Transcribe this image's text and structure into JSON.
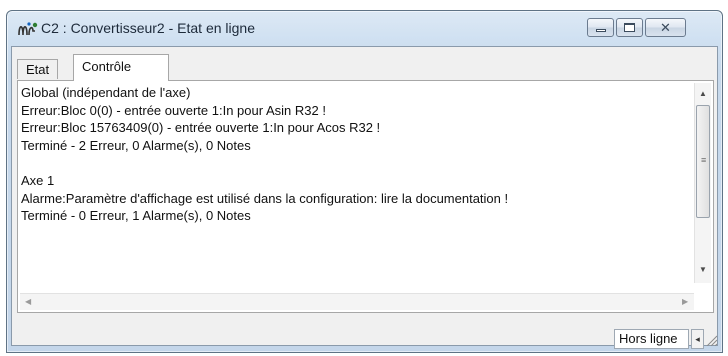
{
  "window": {
    "title": "C2 : Convertisseur2 - Etat en ligne"
  },
  "tabs": [
    {
      "label": "Etat",
      "active": false
    },
    {
      "label": "Contrôle",
      "active": true
    }
  ],
  "log": {
    "lines": [
      "Global (indépendant de l'axe)",
      "Erreur:Bloc 0(0) - entrée ouverte 1:In pour Asin R32 !",
      "Erreur:Bloc 15763409(0) - entrée ouverte 1:In pour Acos R32 !",
      "Terminé - 2 Erreur, 0 Alarme(s), 0 Notes",
      "",
      "Axe 1",
      "Alarme:Paramètre d'affichage est utilisé dans la configuration: lire la documentation !",
      "Terminé - 0 Erreur, 1 Alarme(s), 0 Notes"
    ]
  },
  "statusbar": {
    "pane_text": "Hors ligne"
  },
  "icons": {
    "app": "app-icon",
    "minimize": "minimize-icon",
    "maximize": "maximize-icon",
    "close": "close-icon"
  }
}
